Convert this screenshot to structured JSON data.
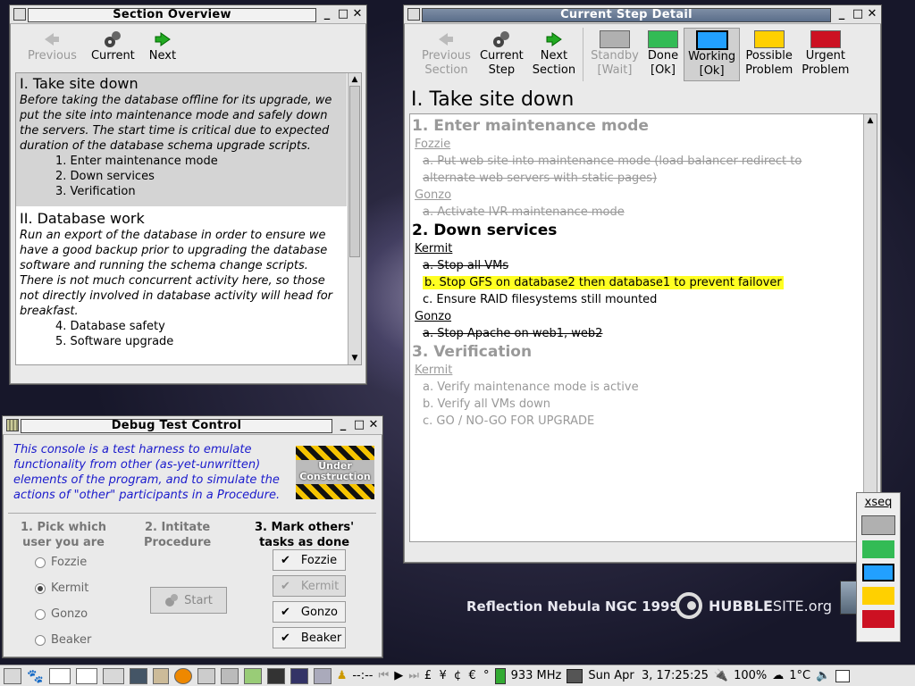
{
  "desktop": {
    "caption": "Reflection Nebula NGC 1999",
    "hubble_brand_a": "HUBBLE",
    "hubble_brand_b": "SITE.org"
  },
  "section_overview": {
    "title": "Section Overview",
    "toolbar": {
      "previous": "Previous",
      "current": "Current",
      "next": "Next"
    },
    "sections": [
      {
        "heading": "I. Take site down",
        "text": "Before taking the database offline for its upgrade, we put the site into maintenance mode and safely down the servers. The start time is critical due to expected duration of the database schema upgrade scripts.",
        "steps": [
          "1. Enter maintenance mode",
          "2. Down services",
          "3. Verification"
        ]
      },
      {
        "heading": "II. Database work",
        "text": "Run an export of the database in order to ensure we have a good backup prior to upgrading the database software and running the schema change scripts. There is not much concurrent activity here, so those not directly involved in database activity will head for breakfast.",
        "steps": [
          "4. Database safety",
          "5. Software upgrade"
        ]
      }
    ]
  },
  "current_step": {
    "title": "Current Step Detail",
    "toolbar": {
      "prev_l1": "Previous",
      "prev_l2": "Section",
      "cur_l1": "Current",
      "cur_l2": "Step",
      "next_l1": "Next",
      "next_l2": "Section",
      "standby_l1": "Standby",
      "standby_l2": "[Wait]",
      "done_l1": "Done",
      "done_l2": "[Ok]",
      "working_l1": "Working",
      "working_l2": "[Ok]",
      "possible_l1": "Possible",
      "possible_l2": "Problem",
      "urgent_l1": "Urgent",
      "urgent_l2": "Problem"
    },
    "colors": {
      "standby": "#b0b0b0",
      "done": "#33bb55",
      "working": "#22a0ff",
      "possible": "#ffd000",
      "urgent": "#cc1122"
    },
    "heading": "I. Take site down",
    "step1": {
      "title": "1. Enter maintenance mode",
      "who1": "Fozzie",
      "t1": "a. Put web site into maintenance mode (load balancer redirect to alternate web servers with static pages)",
      "who2": "Gonzo",
      "t2": "a. Activate IVR maintenance mode"
    },
    "step2": {
      "title": "2. Down services",
      "who1": "Kermit",
      "t1": "a. Stop all VMs",
      "t2": "b. Stop GFS on database2 then database1 to prevent failover",
      "t3": "c. Ensure RAID filesystems still mounted",
      "who2": "Gonzo",
      "t4": "a. Stop Apache on web1, web2"
    },
    "step3": {
      "title": "3. Verification",
      "who1": "Kermit",
      "t1": "a. Verify maintenance mode is active",
      "t2": "b. Verify all VMs down",
      "t3": "c. GO / NO-GO FOR UPGRADE"
    }
  },
  "debug": {
    "title": "Debug Test Control",
    "intro": "This console is a test harness to emulate functionality from other (as-yet-unwritten) elements of the program, and to simulate the actions of \"other\" participants in a Procedure.",
    "badge_l1": "Under",
    "badge_l2": "Construction",
    "col1_l1": "1. Pick which",
    "col1_l2": "user you are",
    "col2_l1": "2. Intitate",
    "col2_l2": "Procedure",
    "col3_l1": "3. Mark others'",
    "col3_l2": "tasks as done",
    "users": [
      "Fozzie",
      "Kermit",
      "Gonzo",
      "Beaker"
    ],
    "start": "Start"
  },
  "xseq": {
    "label": "xseq"
  },
  "taskbar": {
    "currency": "£  ¥  ¢  €  °",
    "cpu": "933 MHz",
    "clock": "Sun Apr  3, 17:25:25",
    "battery": "100%",
    "temp": "1°C",
    "dashes": "--:--"
  }
}
